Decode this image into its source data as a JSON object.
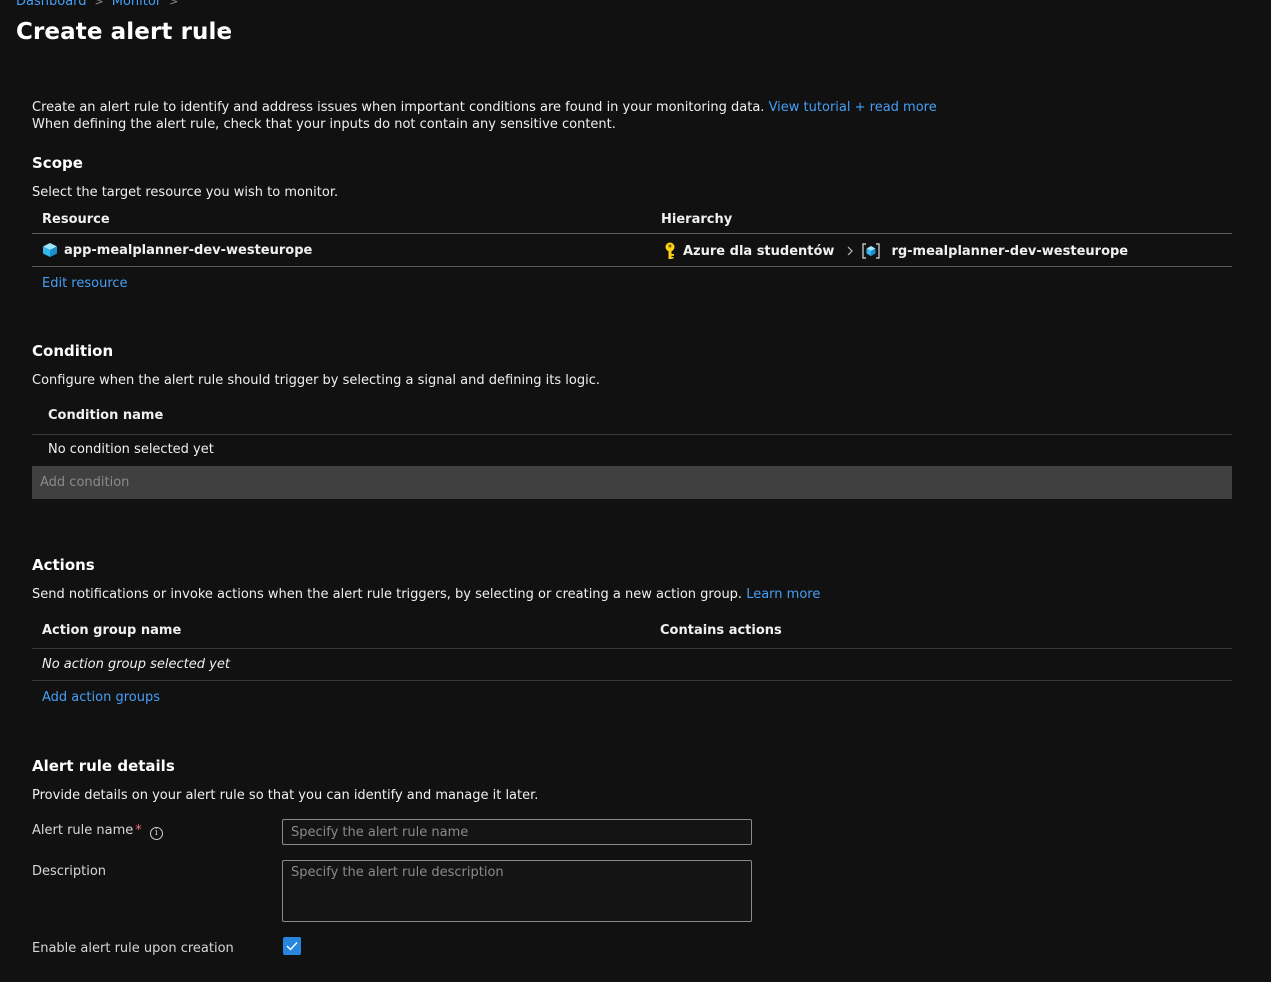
{
  "breadcrumb": [
    {
      "label": "Dashboard"
    },
    {
      "label": "Monitor"
    }
  ],
  "page": {
    "title": "Create alert rule",
    "more_label": "···"
  },
  "intro": {
    "line1": "Create an alert rule to identify and address issues when important conditions are found in your monitoring data.",
    "link": "View tutorial + read more",
    "line2": "When defining the alert rule, check that your inputs do not contain any sensitive content."
  },
  "scope": {
    "title": "Scope",
    "description": "Select the target resource you wish to monitor.",
    "col_resource": "Resource",
    "col_hierarchy": "Hierarchy",
    "resource_name": "app-mealplanner-dev-westeurope",
    "hierarchy_subscription": "Azure dla studentów",
    "hierarchy_resource_group": "rg-mealplanner-dev-westeurope",
    "edit_link": "Edit resource"
  },
  "condition": {
    "title": "Condition",
    "description": "Configure when the alert rule should trigger by selecting a signal and defining its logic.",
    "col_name": "Condition name",
    "empty_text": "No condition selected yet",
    "add_label": "Add condition"
  },
  "actions": {
    "title": "Actions",
    "description": "Send notifications or invoke actions when the alert rule triggers, by selecting or creating a new action group.",
    "learn_more": "Learn more",
    "col_group_name": "Action group name",
    "col_contains": "Contains actions",
    "empty_text": "No action group selected yet",
    "add_link": "Add action groups"
  },
  "details": {
    "title": "Alert rule details",
    "description": "Provide details on your alert rule so that you can identify and manage it later.",
    "name_label": "Alert rule name",
    "required_mark": "*",
    "info_icon": "i",
    "name_placeholder": "Specify the alert rule name",
    "description_label": "Description",
    "description_placeholder": "Specify the alert rule description",
    "enable_label": "Enable alert rule upon creation",
    "enable_checked": true
  },
  "colors": {
    "background": "#111111",
    "link": "#479ef5",
    "accent": "#2886de",
    "required": "#f1707b"
  },
  "icons": {
    "resource": "app-service-cube-icon",
    "subscription": "key-icon",
    "resource_group": "resource-group-icon",
    "chevron": "chevron-right-icon",
    "check": "checkmark-icon"
  }
}
